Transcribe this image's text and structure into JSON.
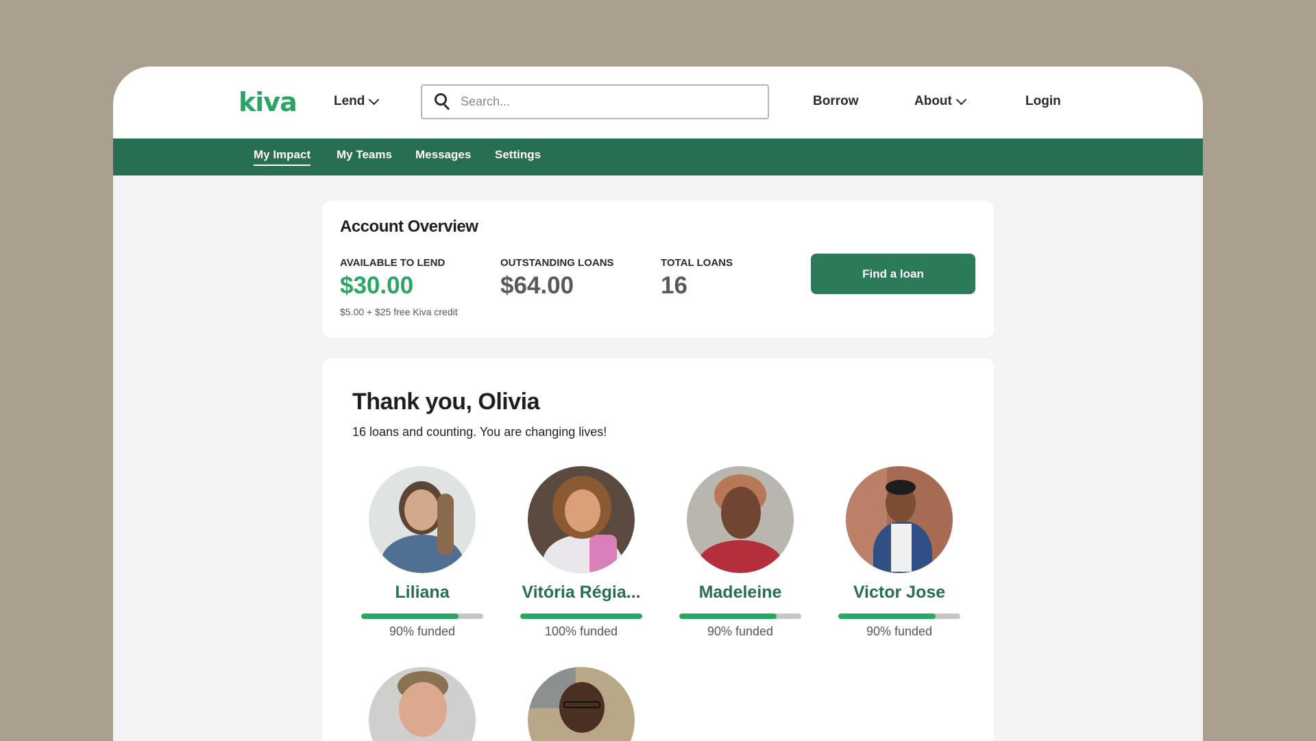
{
  "brand": {
    "logo": "kiva"
  },
  "topnav": {
    "lend": "Lend",
    "search_placeholder": "Search...",
    "borrow": "Borrow",
    "about": "About",
    "login": "Login"
  },
  "subnav": {
    "items": [
      {
        "label": "My Impact",
        "active": true
      },
      {
        "label": "My Teams",
        "active": false
      },
      {
        "label": "Messages",
        "active": false
      },
      {
        "label": "Settings",
        "active": false
      }
    ]
  },
  "overview": {
    "title": "Account Overview",
    "available_label": "AVAILABLE TO LEND",
    "available_value": "$30.00",
    "available_note": "$5.00 + $25 free Kiva credit",
    "outstanding_label": "OUTSTANDING LOANS",
    "outstanding_value": "$64.00",
    "total_label": "TOTAL LOANS",
    "total_value": "16",
    "find_button": "Find a loan"
  },
  "thanks": {
    "title": "Thank you, Olivia",
    "subtitle": "16 loans and counting. You are changing lives!",
    "borrowers": [
      {
        "name": "Liliana",
        "funded_label": "90% funded",
        "funded_pct": 0.8
      },
      {
        "name": "Vitória Régia...",
        "funded_label": "100% funded",
        "funded_pct": 1.0
      },
      {
        "name": "Madeleine",
        "funded_label": "90% funded",
        "funded_pct": 0.8
      },
      {
        "name": "Victor Jose",
        "funded_label": "90% funded",
        "funded_pct": 0.8
      }
    ]
  },
  "colors": {
    "brand_green": "#2aa664",
    "subnav_green": "#276e52",
    "button_green": "#2b7a58",
    "backdrop": "#aba08f"
  }
}
